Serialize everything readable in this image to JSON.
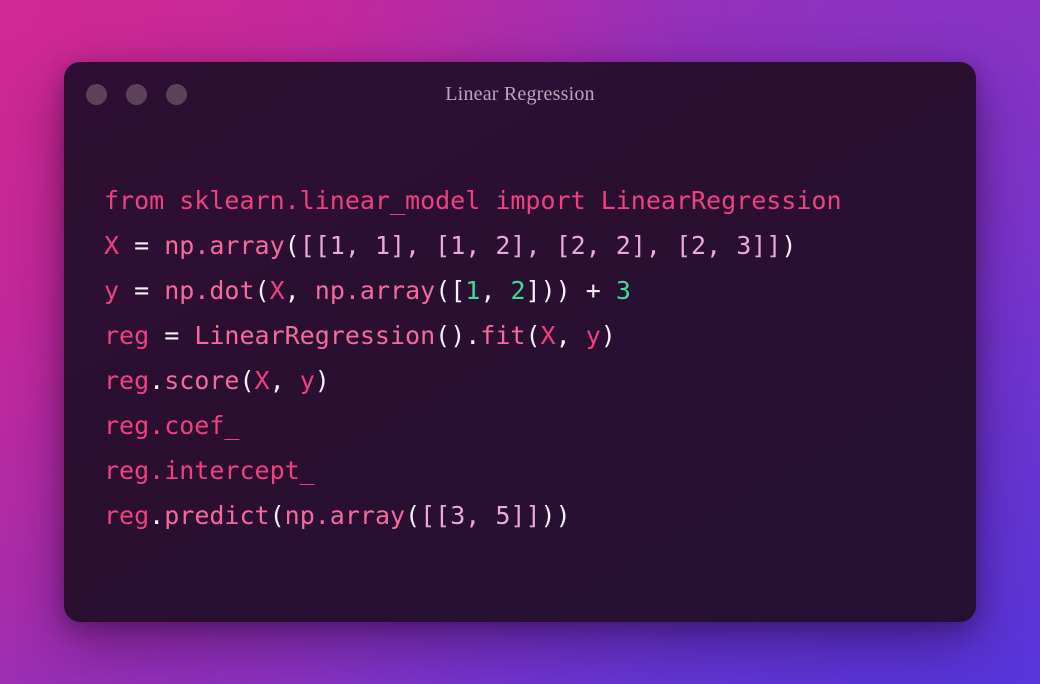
{
  "window": {
    "title": "Linear Regression",
    "traffic_lights": [
      {
        "name": "close",
        "color": "#5c4158"
      },
      {
        "name": "minimize",
        "color": "#5c4158"
      },
      {
        "name": "maximize",
        "color": "#5c4158"
      }
    ]
  },
  "theme": {
    "backdrop_top_left": "#c8268d",
    "backdrop_top_right": "#8a33c4",
    "backdrop_bottom_left": "#9a2fb5",
    "backdrop_bottom_right": "#5b37d8",
    "window_background": "#2a0f31",
    "title_color": "#b9a5bc",
    "token_name": "#f0417e",
    "token_function": "#f56a9b",
    "token_punctuation": "#f6f1f6",
    "token_number_lavender": "#e8a8e0",
    "token_number_green": "#3ddc97"
  },
  "code": {
    "language": "python",
    "plain_text": "from sklearn.linear_model import LinearRegression\nX = np.array([[1, 1], [1, 2], [2, 2], [2, 3]])\ny = np.dot(X, np.array([1, 2])) + 3\nreg = LinearRegression().fit(X, y)\nreg.score(X, y)\nreg.coef_\nreg.intercept_\nreg.predict(np.array([[3, 5]]))",
    "lines": [
      {
        "index": 1,
        "text": "from sklearn.linear_model import LinearRegression",
        "tokens": [
          {
            "t": "from sklearn.linear_model import LinearRegression",
            "c": "name"
          }
        ]
      },
      {
        "index": 2,
        "text": "X = np.array([[1, 1], [1, 2], [2, 2], [2, 3]])",
        "tokens": [
          {
            "t": "X",
            "c": "name"
          },
          {
            "t": " = ",
            "c": "punct"
          },
          {
            "t": "np.array",
            "c": "fn"
          },
          {
            "t": "(",
            "c": "punct"
          },
          {
            "t": "[[1, 1], [1, 2], [2, 2], [2, 3]]",
            "c": "num"
          },
          {
            "t": ")",
            "c": "punct"
          }
        ]
      },
      {
        "index": 3,
        "text": "y = np.dot(X, np.array([1, 2])) + 3",
        "tokens": [
          {
            "t": "y",
            "c": "name"
          },
          {
            "t": " = ",
            "c": "punct"
          },
          {
            "t": "np.dot",
            "c": "fn"
          },
          {
            "t": "(",
            "c": "punct"
          },
          {
            "t": "X",
            "c": "name"
          },
          {
            "t": ", ",
            "c": "punct"
          },
          {
            "t": "np.array",
            "c": "fn"
          },
          {
            "t": "([",
            "c": "punct"
          },
          {
            "t": "1",
            "c": "num2"
          },
          {
            "t": ", ",
            "c": "punct"
          },
          {
            "t": "2",
            "c": "num2"
          },
          {
            "t": "])) + ",
            "c": "punct"
          },
          {
            "t": "3",
            "c": "num2"
          }
        ]
      },
      {
        "index": 4,
        "text": "reg = LinearRegression().fit(X, y)",
        "tokens": [
          {
            "t": "reg",
            "c": "name"
          },
          {
            "t": " = ",
            "c": "punct"
          },
          {
            "t": "LinearRegression",
            "c": "fn"
          },
          {
            "t": "().",
            "c": "punct"
          },
          {
            "t": "fit",
            "c": "fn"
          },
          {
            "t": "(",
            "c": "punct"
          },
          {
            "t": "X",
            "c": "name"
          },
          {
            "t": ", ",
            "c": "punct"
          },
          {
            "t": "y",
            "c": "name"
          },
          {
            "t": ")",
            "c": "punct"
          }
        ]
      },
      {
        "index": 5,
        "text": "reg.score(X, y)",
        "tokens": [
          {
            "t": "reg",
            "c": "name"
          },
          {
            "t": ".",
            "c": "punct"
          },
          {
            "t": "score",
            "c": "fn"
          },
          {
            "t": "(",
            "c": "punct"
          },
          {
            "t": "X",
            "c": "name"
          },
          {
            "t": ", ",
            "c": "punct"
          },
          {
            "t": "y",
            "c": "name"
          },
          {
            "t": ")",
            "c": "punct"
          }
        ]
      },
      {
        "index": 6,
        "text": "reg.coef_",
        "tokens": [
          {
            "t": "reg.coef_",
            "c": "name"
          }
        ]
      },
      {
        "index": 7,
        "text": "reg.intercept_",
        "tokens": [
          {
            "t": "reg.intercept_",
            "c": "name"
          }
        ]
      },
      {
        "index": 8,
        "text": "reg.predict(np.array([[3, 5]]))",
        "tokens": [
          {
            "t": "reg",
            "c": "name"
          },
          {
            "t": ".",
            "c": "punct"
          },
          {
            "t": "predict",
            "c": "fn"
          },
          {
            "t": "(",
            "c": "punct"
          },
          {
            "t": "np.array",
            "c": "fn"
          },
          {
            "t": "(",
            "c": "punct"
          },
          {
            "t": "[[3, 5]]",
            "c": "num"
          },
          {
            "t": "))",
            "c": "punct"
          }
        ]
      }
    ]
  }
}
